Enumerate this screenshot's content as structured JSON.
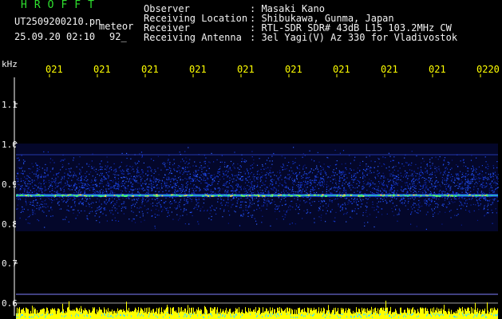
{
  "header": {
    "brand": "HROFFT",
    "filename": "UT2509200210.pn",
    "meteor_label": "meteor",
    "datetime": "25.09.20 02:10",
    "count": "92_"
  },
  "metadata": [
    {
      "label": "Observer",
      "value": ": Masaki Kano"
    },
    {
      "label": "Receiving Location",
      "value": ": Shibukawa, Gunma, Japan"
    },
    {
      "label": "Receiver",
      "value": ": RTL-SDR SDR# 43dB L15 103.2MHz CW"
    },
    {
      "label": "Receiving Antenna",
      "value": ": 3el Yagi(V) Az 330 for Vladivostok"
    }
  ],
  "chart_data": {
    "type": "heatmap",
    "yunit": "kHz",
    "y_ticks": [
      "1.1",
      "1.0",
      "0.9",
      "0.8",
      "0.7",
      "0.6"
    ],
    "ylim": [
      0.6,
      1.15
    ],
    "x_ticks": [
      "021",
      "021",
      "021",
      "021",
      "021",
      "021",
      "021",
      "021",
      "021",
      "0220"
    ],
    "signal_band_khz": [
      0.8,
      0.98
    ],
    "carrier_khz": 0.87,
    "colors": {
      "background": "#000000",
      "noise": "#1230c8",
      "carrier": "#32e0c8",
      "bottom_bars": "#ffff00"
    }
  }
}
